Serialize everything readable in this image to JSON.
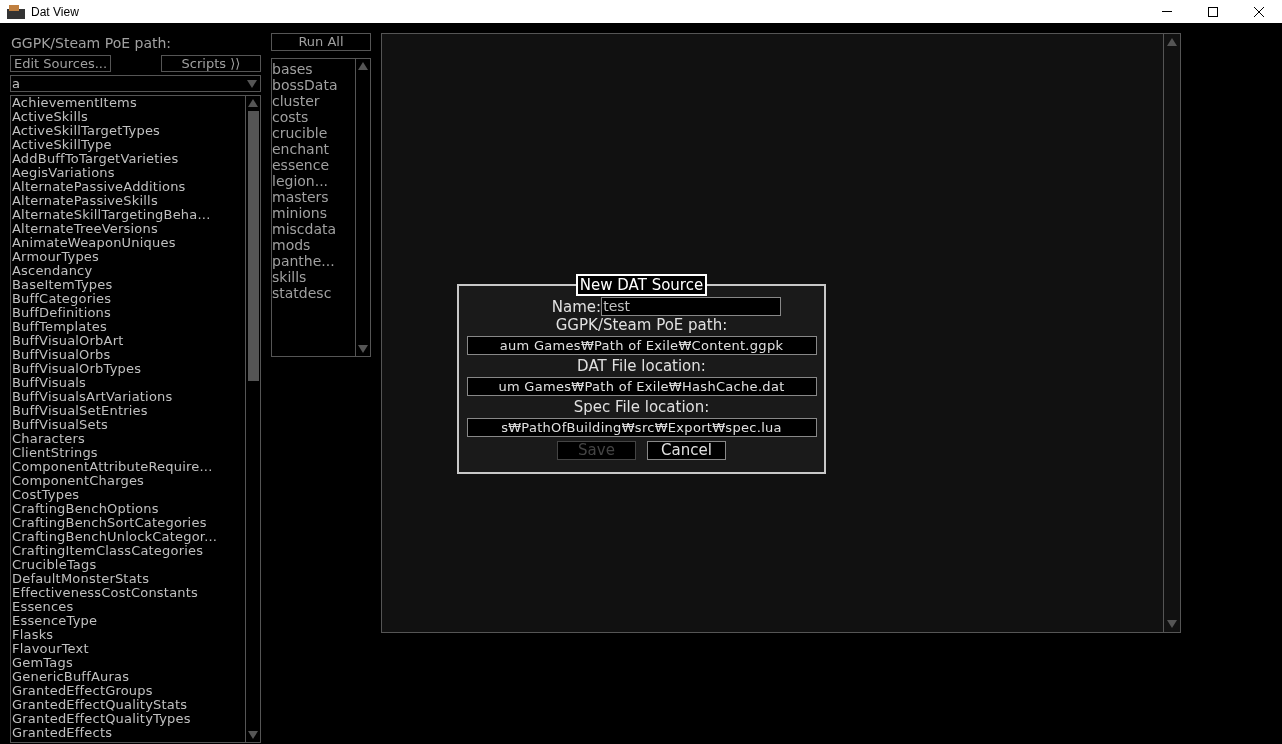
{
  "window": {
    "title": "Dat View"
  },
  "source_label": "GGPK/Steam PoE path:",
  "edit_sources_button": "Edit Sources...",
  "scripts_button": "Scripts ⟩⟩",
  "source_dropdown": {
    "value": "a"
  },
  "dat_list": [
    "AchievementItems",
    "ActiveSkills",
    "ActiveSkillTargetTypes",
    "ActiveSkillType",
    "AddBuffToTargetVarieties",
    "AegisVariations",
    "AlternatePassiveAdditions",
    "AlternatePassiveSkills",
    "AlternateSkillTargetingBeha...",
    "AlternateTreeVersions",
    "AnimateWeaponUniques",
    "ArmourTypes",
    "Ascendancy",
    "BaseItemTypes",
    "BuffCategories",
    "BuffDefinitions",
    "BuffTemplates",
    "BuffVisualOrbArt",
    "BuffVisualOrbs",
    "BuffVisualOrbTypes",
    "BuffVisuals",
    "BuffVisualsArtVariations",
    "BuffVisualSetEntries",
    "BuffVisualSets",
    "Characters",
    "ClientStrings",
    "ComponentAttributeRequire...",
    "ComponentCharges",
    "CostTypes",
    "CraftingBenchOptions",
    "CraftingBenchSortCategories",
    "CraftingBenchUnlockCategor...",
    "CraftingItemClassCategories",
    "CrucibleTags",
    "DefaultMonsterStats",
    "EffectivenessCostConstants",
    "Essences",
    "EssenceType",
    "Flasks",
    "FlavourText",
    "GemTags",
    "GenericBuffAuras",
    "GrantedEffectGroups",
    "GrantedEffectQualityStats",
    "GrantedEffectQualityTypes",
    "GrantedEffects"
  ],
  "run_all_button": "Run All",
  "scripts": [
    "bases",
    "bossData",
    "cluster",
    "costs",
    "crucible",
    "enchant",
    "essence",
    "legion...",
    "masters",
    "minions",
    "miscdata",
    "mods",
    "panthe...",
    "skills",
    "statdesc"
  ],
  "dialog": {
    "title": "New DAT Source",
    "name_label": "Name:",
    "name_value": "test",
    "fields": [
      {
        "label": "GGPK/Steam PoE path:",
        "value": "aum Games₩Path of Exile₩Content.ggpk"
      },
      {
        "label": "DAT File location:",
        "value": "um Games₩Path of Exile₩HashCache.dat"
      },
      {
        "label": "Spec File location:",
        "value": "s₩PathOfBuilding₩src₩Export₩spec.lua"
      }
    ],
    "buttons": [
      {
        "label": "Save",
        "disabled": true
      },
      {
        "label": "Cancel",
        "disabled": false
      }
    ]
  }
}
